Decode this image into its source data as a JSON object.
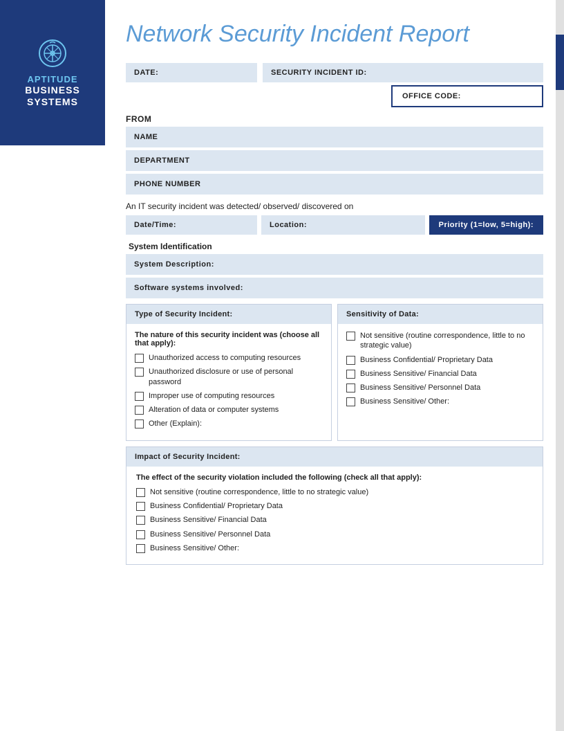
{
  "sidebar": {
    "brand_top": "APTITUDE",
    "brand_bottom": "BUSINESS\nSYSTEMS"
  },
  "header": {
    "title": "Network Security Incident Report"
  },
  "form": {
    "date_label": "DATE:",
    "incident_id_label": "SECURITY INCIDENT ID:",
    "office_code_label": "OFFICE CODE:",
    "from_label": "FROM",
    "name_label": "NAME",
    "department_label": "DEPARTMENT",
    "phone_label": "PHONE NUMBER",
    "it_text": "An IT security incident was detected/ observed/ discovered on",
    "datetime_label": "Date/Time:",
    "location_label": "Location:",
    "priority_label": "Priority (1=low, 5=high):",
    "system_id_label": "System Identification",
    "system_desc_label": "System Description:",
    "software_label": "Software systems involved:",
    "type_header": "Type of Security Incident:",
    "sensitivity_header": "Sensitivity of Data:",
    "nature_text": "The nature of this security incident was (choose all that apply):",
    "type_items": [
      "Unauthorized access to computing resources",
      "Unauthorized disclosure or use of personal password",
      "Improper use of computing resources",
      "Alteration of data or computer systems",
      "Other (Explain):"
    ],
    "sensitivity_items": [
      "Not sensitive (routine correspondence, little to no strategic value)",
      "Business Confidential/ Proprietary Data",
      "Business Sensitive/ Financial Data",
      "Business Sensitive/ Personnel Data",
      "Business Sensitive/ Other:"
    ],
    "impact_header": "Impact of Security Incident:",
    "effect_text": "The effect of the security violation included the following (check all that apply):",
    "impact_items": [
      "Not sensitive (routine correspondence, little to no strategic value)",
      "Business Confidential/ Proprietary Data",
      "Business Sensitive/ Financial Data",
      "Business Sensitive/ Personnel Data",
      "Business Sensitive/ Other:"
    ]
  }
}
